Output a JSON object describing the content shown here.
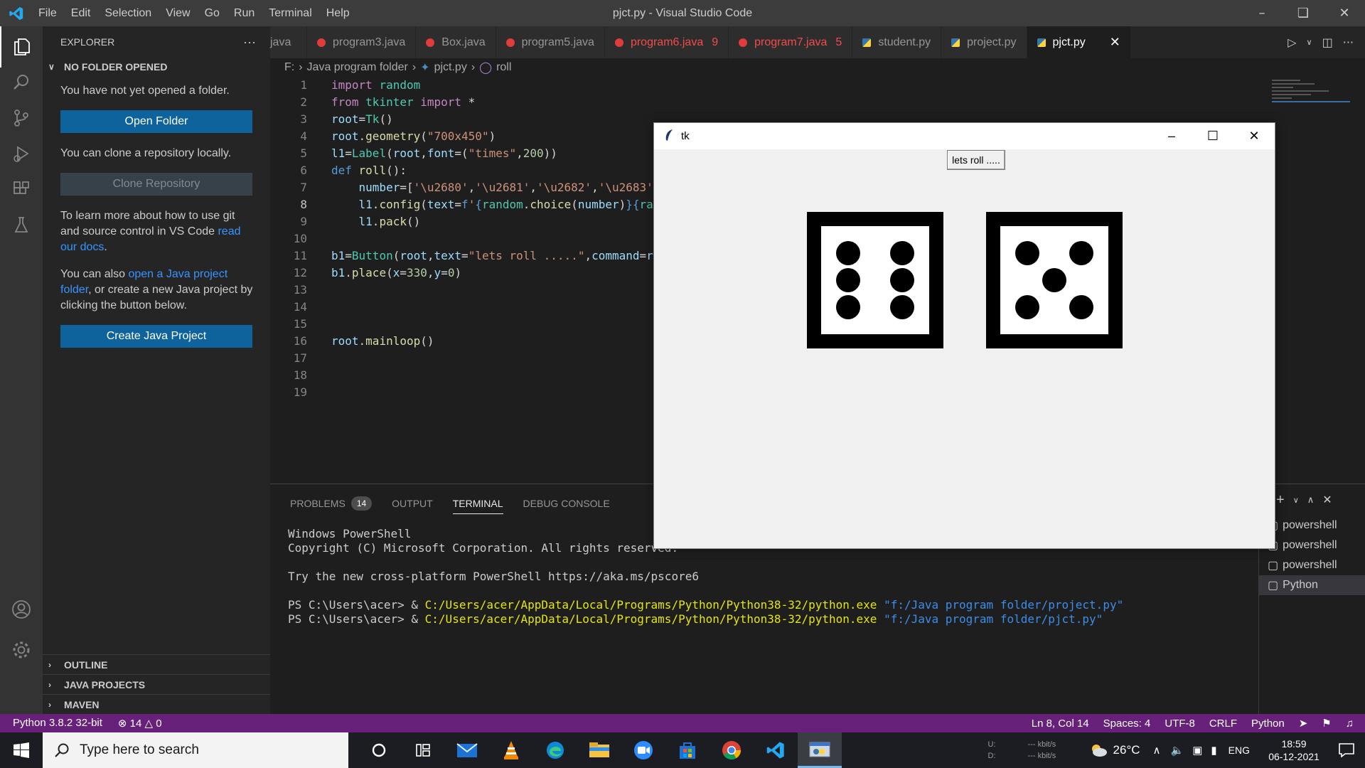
{
  "window": {
    "title": "pjct.py - Visual Studio Code"
  },
  "menu": [
    "File",
    "Edit",
    "Selection",
    "View",
    "Go",
    "Run",
    "Terminal",
    "Help"
  ],
  "sidebar": {
    "title": "EXPLORER",
    "more": "···",
    "section": "NO FOLDER OPENED",
    "msg1": "You have not yet opened a folder.",
    "open_folder": "Open Folder",
    "msg2": "You can clone a repository locally.",
    "clone_repo": "Clone Repository",
    "msg3_pre": "To learn more about how to use git and source control in VS Code ",
    "msg3_link": "read our docs",
    "msg3_post": ".",
    "msg4_pre": "You can also ",
    "msg4_link": "open a Java project folder",
    "msg4_post": ", or create a new Java project by clicking the button below.",
    "create_java": "Create Java Project",
    "bottom_sections": [
      "OUTLINE",
      "JAVA PROJECTS",
      "MAVEN"
    ]
  },
  "tabs": [
    {
      "label": "java",
      "kind": "java",
      "error": false,
      "badge": ""
    },
    {
      "label": "program3.java",
      "kind": "java",
      "error": false,
      "badge": ""
    },
    {
      "label": "Box.java",
      "kind": "java",
      "error": false,
      "badge": ""
    },
    {
      "label": "program5.java",
      "kind": "java",
      "error": false,
      "badge": ""
    },
    {
      "label": "program6.java",
      "kind": "java",
      "error": true,
      "badge": "9"
    },
    {
      "label": "program7.java",
      "kind": "java",
      "error": true,
      "badge": "5"
    },
    {
      "label": "student.py",
      "kind": "python",
      "error": false,
      "badge": ""
    },
    {
      "label": "project.py",
      "kind": "python",
      "error": false,
      "badge": ""
    },
    {
      "label": "pjct.py",
      "kind": "python",
      "error": false,
      "badge": "",
      "active": true
    }
  ],
  "breadcrumb": {
    "drive": "F:",
    "folder": "Java program folder",
    "file": "pjct.py",
    "symbol": "roll"
  },
  "editor": {
    "current_line": 8,
    "line_numbers": [
      "1",
      "2",
      "3",
      "4",
      "5",
      "6",
      "7",
      "8",
      "9",
      "10",
      "11",
      "12",
      "13",
      "14",
      "15",
      "16",
      "17",
      "18",
      "19"
    ]
  },
  "panel": {
    "tabs": [
      "PROBLEMS",
      "OUTPUT",
      "TERMINAL",
      "DEBUG CONSOLE"
    ],
    "problems_count": "14",
    "active_tab": "TERMINAL",
    "terminal": {
      "line1": "Windows PowerShell",
      "line2": "Copyright (C) Microsoft Corporation. All rights reserved.",
      "line3": "Try the new cross-platform PowerShell https://aka.ms/pscore6",
      "prompt": "PS C:\\Users\\acer> & ",
      "exe": "C:/Users/acer/AppData/Local/Programs/Python/Python38-32/python.exe",
      "arg1": "\"f:/Java program folder/project.py\"",
      "arg2": "\"f:/Java program folder/pjct.py\""
    },
    "terminal_list": [
      "powershell",
      "powershell",
      "powershell",
      "Python"
    ]
  },
  "tk": {
    "title": "tk",
    "button": "lets roll .....",
    "die1": 6,
    "die2": 5
  },
  "status": {
    "interpreter": "Python 3.8.2 32-bit",
    "errors": "14",
    "warnings": "0",
    "position": "Ln 8, Col 14",
    "spaces": "Spaces: 4",
    "encoding": "UTF-8",
    "eol": "CRLF",
    "language": "Python"
  },
  "taskbar": {
    "search_placeholder": "Type here to search",
    "net_u_label": "U:",
    "net_d_label": "D:",
    "net_u": "--- kbit/s",
    "net_d": "--- kbit/s",
    "temperature": "26°C",
    "lang": "ENG",
    "time": "18:59",
    "date": "06-12-2021"
  },
  "colors": {
    "accent": "#0e639c",
    "statusbar": "#68217a",
    "error": "#f14c4c",
    "link": "#3794ff"
  }
}
